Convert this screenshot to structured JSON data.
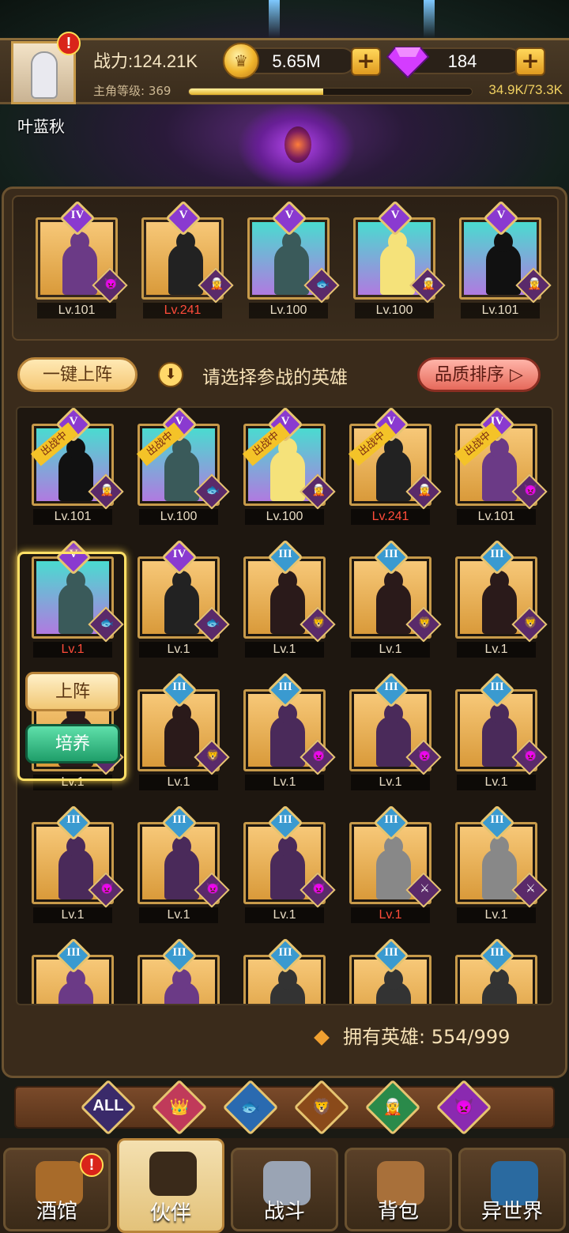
{
  "player": {
    "name": "叶蓝秋",
    "power": "战力:124.21K",
    "gold": "5.65M",
    "gems": "184",
    "level_label": "主角等级: 369",
    "exp_text": "34.9K/73.3K",
    "exp_progress": 0.476
  },
  "toolbar": {
    "lineup_label": "一键上阵",
    "hint_text": "请选择参战的英雄",
    "sort_label": "品质排序"
  },
  "lineup": [
    {
      "rank": "IV",
      "level": "Lv.101",
      "red": false,
      "bg": "#e6a444",
      "skin": "#6b3a86",
      "faction": "👿"
    },
    {
      "rank": "V",
      "level": "Lv.241",
      "red": true,
      "bg": "#e6a444",
      "skin": "#222",
      "faction": "🧝"
    },
    {
      "rank": "V",
      "level": "Lv.100",
      "red": false,
      "bg": "teal",
      "skin": "#3a5a5a",
      "faction": "🐟"
    },
    {
      "rank": "V",
      "level": "Lv.100",
      "red": false,
      "bg": "teal",
      "skin": "#f5e27a",
      "faction": "🧝"
    },
    {
      "rank": "V",
      "level": "Lv.101",
      "red": false,
      "bg": "teal",
      "skin": "#111",
      "faction": "🧝"
    }
  ],
  "heroes": [
    {
      "rank": "V",
      "level": "Lv.101",
      "red": false,
      "bg": "teal",
      "skin": "#111",
      "faction": "🧝",
      "tag": "出战中"
    },
    {
      "rank": "V",
      "level": "Lv.100",
      "red": false,
      "bg": "teal",
      "skin": "#3a5a5a",
      "faction": "🐟",
      "tag": "出战中"
    },
    {
      "rank": "V",
      "level": "Lv.100",
      "red": false,
      "bg": "teal",
      "skin": "#f5e27a",
      "faction": "🧝",
      "tag": "出战中"
    },
    {
      "rank": "V",
      "level": "Lv.241",
      "red": true,
      "bg": "#e6a444",
      "skin": "#222",
      "faction": "🧝",
      "tag": "出战中"
    },
    {
      "rank": "IV",
      "level": "Lv.101",
      "red": false,
      "bg": "#e6a444",
      "skin": "#6b3a86",
      "faction": "👿",
      "tag": "出战中"
    },
    {
      "rank": "V",
      "level": "Lv.1",
      "red": true,
      "bg": "teal",
      "skin": "#3a5a5a",
      "faction": "🐟",
      "tag": ""
    },
    {
      "rank": "IV",
      "level": "Lv.1",
      "red": false,
      "bg": "#e6a444",
      "skin": "#222",
      "faction": "🐟",
      "tag": ""
    },
    {
      "rank": "III",
      "level": "Lv.1",
      "red": false,
      "bg": "#e6a444",
      "skin": "#2a1a1a",
      "faction": "🦁",
      "tag": ""
    },
    {
      "rank": "III",
      "level": "Lv.1",
      "red": false,
      "bg": "#e6a444",
      "skin": "#2a1a1a",
      "faction": "🦁",
      "tag": ""
    },
    {
      "rank": "III",
      "level": "Lv.1",
      "red": false,
      "bg": "#e6a444",
      "skin": "#2a1a1a",
      "faction": "🦁",
      "tag": ""
    },
    {
      "rank": "III",
      "level": "Lv.1",
      "red": false,
      "bg": "#e6a444",
      "skin": "#2a1a1a",
      "faction": "🦁",
      "tag": ""
    },
    {
      "rank": "III",
      "level": "Lv.1",
      "red": false,
      "bg": "#e6a444",
      "skin": "#2a1a1a",
      "faction": "🦁",
      "tag": ""
    },
    {
      "rank": "III",
      "level": "Lv.1",
      "red": false,
      "bg": "#e6a444",
      "skin": "#4a2a5a",
      "faction": "👿",
      "tag": ""
    },
    {
      "rank": "III",
      "level": "Lv.1",
      "red": false,
      "bg": "#e6a444",
      "skin": "#4a2a5a",
      "faction": "👿",
      "tag": ""
    },
    {
      "rank": "III",
      "level": "Lv.1",
      "red": false,
      "bg": "#e6a444",
      "skin": "#4a2a5a",
      "faction": "👿",
      "tag": ""
    },
    {
      "rank": "III",
      "level": "Lv.1",
      "red": false,
      "bg": "#e6a444",
      "skin": "#4a2a5a",
      "faction": "👿",
      "tag": ""
    },
    {
      "rank": "III",
      "level": "Lv.1",
      "red": false,
      "bg": "#e6a444",
      "skin": "#4a2a5a",
      "faction": "👿",
      "tag": ""
    },
    {
      "rank": "III",
      "level": "Lv.1",
      "red": false,
      "bg": "#e6a444",
      "skin": "#4a2a5a",
      "faction": "👿",
      "tag": ""
    },
    {
      "rank": "III",
      "level": "Lv.1",
      "red": true,
      "bg": "#e6a444",
      "skin": "#888",
      "faction": "⚔",
      "tag": ""
    },
    {
      "rank": "III",
      "level": "Lv.1",
      "red": false,
      "bg": "#e6a444",
      "skin": "#888",
      "faction": "⚔",
      "tag": ""
    },
    {
      "rank": "III",
      "level": "",
      "red": false,
      "bg": "#e6a444",
      "skin": "#6b3a86",
      "faction": "",
      "tag": ""
    },
    {
      "rank": "III",
      "level": "",
      "red": false,
      "bg": "#e6a444",
      "skin": "#6b3a86",
      "faction": "",
      "tag": ""
    },
    {
      "rank": "III",
      "level": "",
      "red": false,
      "bg": "#e6a444",
      "skin": "#333",
      "faction": "",
      "tag": ""
    },
    {
      "rank": "III",
      "level": "",
      "red": false,
      "bg": "#e6a444",
      "skin": "#333",
      "faction": "",
      "tag": ""
    },
    {
      "rank": "III",
      "level": "",
      "red": false,
      "bg": "#e6a444",
      "skin": "#333",
      "faction": "",
      "tag": ""
    }
  ],
  "popup": {
    "deploy_label": "上阵",
    "train_label": "培养"
  },
  "owned": {
    "label": "拥有英雄:",
    "value": "554/999"
  },
  "filters": [
    {
      "label": "ALL",
      "color": "#3a2a6a",
      "icon": "all-filter"
    },
    {
      "label": "👑",
      "color": "#c03a5a",
      "icon": "crown-faction-icon"
    },
    {
      "label": "🐟",
      "color": "#2a6ab0",
      "icon": "fish-faction-icon"
    },
    {
      "label": "🦁",
      "color": "#8a4a1a",
      "icon": "lion-faction-icon"
    },
    {
      "label": "🧝",
      "color": "#2a8a4a",
      "icon": "elf-faction-icon"
    },
    {
      "label": "👿",
      "color": "#8a2ab0",
      "icon": "demon-faction-icon"
    }
  ],
  "nav": [
    {
      "label": "酒馆",
      "icon": "tavern-icon",
      "color": "#a86b2a",
      "alert": true
    },
    {
      "label": "伙伴",
      "icon": "partner-icon",
      "color": "#3a2a1a",
      "active": true
    },
    {
      "label": "战斗",
      "icon": "battle-icon",
      "color": "#9aa4b4"
    },
    {
      "label": "背包",
      "icon": "backpack-icon",
      "color": "#a8703a"
    },
    {
      "label": "异世界",
      "icon": "portal-icon",
      "color": "#2a6aa0"
    }
  ],
  "colors": {
    "accent": "#e6c470",
    "panel": "#3a2b1b",
    "danger": "#ff4c3a"
  }
}
